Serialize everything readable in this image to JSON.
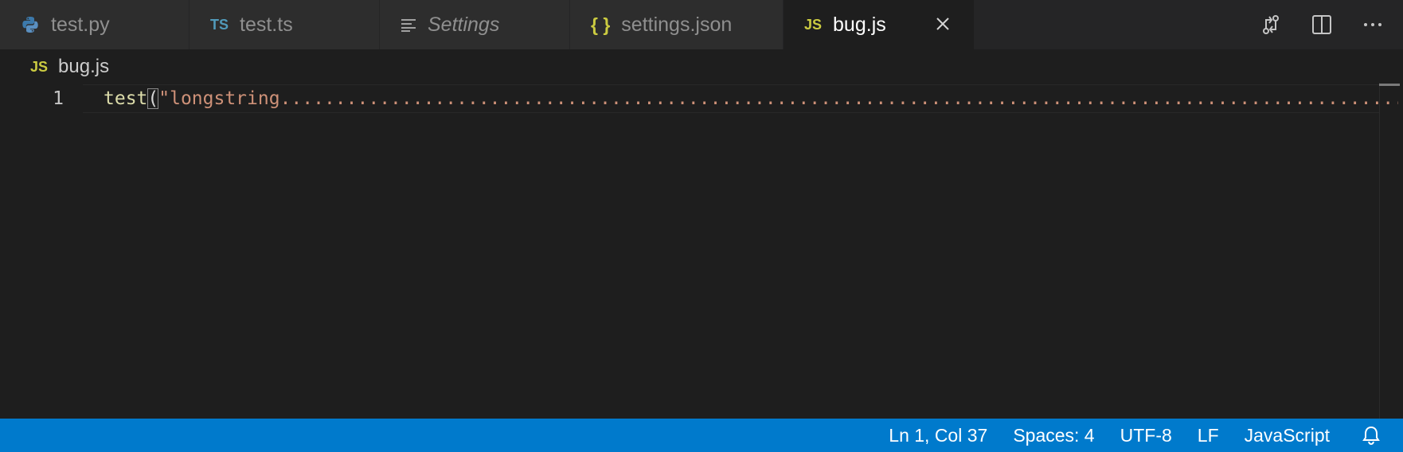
{
  "tabs": [
    {
      "label": "test.py",
      "icon": "python-icon",
      "italic": false,
      "active": false
    },
    {
      "label": "test.ts",
      "icon": "typescript-icon",
      "icon_text": "TS",
      "italic": false,
      "active": false
    },
    {
      "label": "Settings",
      "icon": "settings-list-icon",
      "italic": true,
      "active": false
    },
    {
      "label": "settings.json",
      "icon": "json-icon",
      "icon_text": "{ }",
      "italic": false,
      "active": false
    },
    {
      "label": "bug.js",
      "icon": "javascript-icon",
      "icon_text": "JS",
      "italic": false,
      "active": true
    }
  ],
  "editor_actions": [
    "open-changes-icon",
    "split-editor-icon",
    "more-actions-icon"
  ],
  "breadcrumb": {
    "icon_text": "JS",
    "file": "bug.js"
  },
  "editor": {
    "line_number": "1",
    "tokens": {
      "fn": "test",
      "paren": "(",
      "str": "\"longstring................................................................................................................"
    }
  },
  "status": {
    "position": "Ln 1, Col 37",
    "spaces": "Spaces: 4",
    "encoding": "UTF-8",
    "eol": "LF",
    "language": "JavaScript"
  },
  "colors": {
    "status_bar": "#007acc",
    "js_icon": "#cbcb41",
    "ts_icon": "#519aba",
    "python_icon": "#3c79ab",
    "string": "#ce9178",
    "function": "#dcdcaa"
  }
}
